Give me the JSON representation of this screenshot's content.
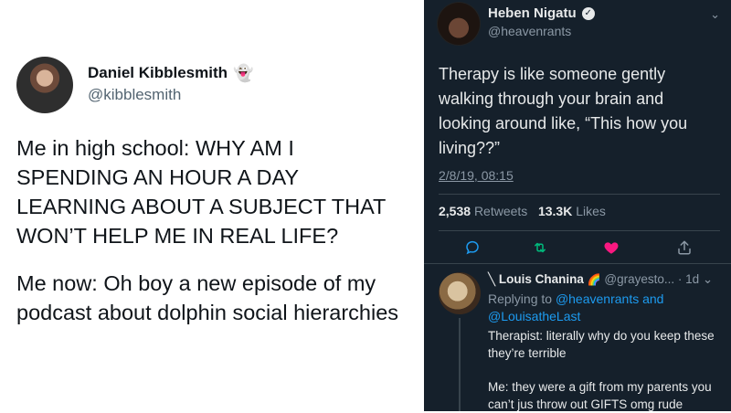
{
  "left_tweet": {
    "author_name": "Daniel Kibblesmith",
    "author_emoji": "👻",
    "handle": "@kibblesmith",
    "paragraphs": [
      "Me in high school: WHY AM I SPENDING AN HOUR A DAY LEARNING ABOUT A SUBJECT THAT WON’T HELP ME IN REAL LIFE?",
      "Me now: Oh boy a new episode of my podcast about dolphin social hierarchies"
    ]
  },
  "right_tweet": {
    "author_name": "Heben Nigatu",
    "verified_glyph": "✓",
    "handle": "@heavenrants",
    "body": "Therapy is like someone gently walking through your brain and looking around like, “This how you living??”",
    "date": "2/8/19, 08:15",
    "retweets_count": "2,538",
    "retweets_label": "Retweets",
    "likes_count": "13.3K",
    "likes_label": "Likes",
    "chevron": "⌄",
    "colors": {
      "background": "#15202b",
      "like": "#f91880",
      "retweet": "#00ba7c",
      "link": "#1d9bf0"
    }
  },
  "reply": {
    "retweet_mark": "╲",
    "author_name": "Louis Chanina",
    "rainbow": "🌈",
    "handle_time": "@grayesto... · 1d",
    "chevron": "⌄",
    "replying_prefix": "Replying to",
    "mention1": "@heavenrants",
    "and_word": "and",
    "mention2": "@LouisatheLast",
    "line1": "Therapist: literally why do you keep these they’re terrible",
    "line2": "Me: they were a gift from my parents you can’t jus throw out GIFTS omg rude"
  }
}
